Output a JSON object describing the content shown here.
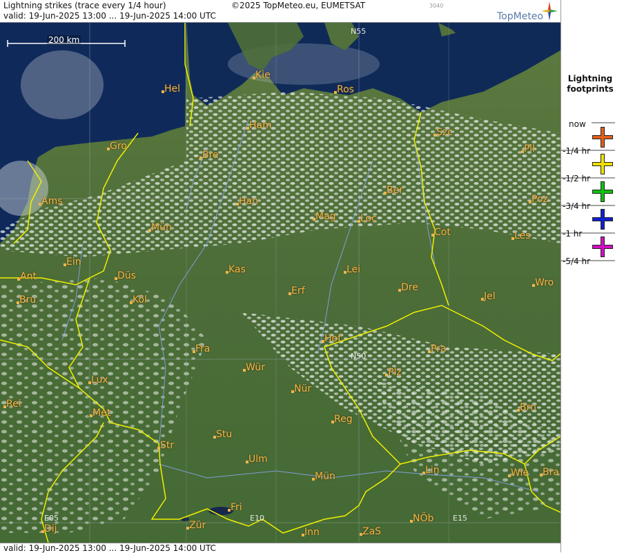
{
  "header": {
    "title": "Lightning strikes (trace every 1/4 hour)",
    "copyright": "©2025 TopMeteo.eu, EUMETSAT",
    "image_number": "3040",
    "valid": "valid:  19-Jun-2025 13:00 ... 19-Jun-2025 14:00 UTC",
    "logo": "TopMeteo"
  },
  "footer": {
    "valid": "valid:  19-Jun-2025 13:00 ... 19-Jun-2025 14:00 UTC"
  },
  "scale": {
    "label": "200 km"
  },
  "grid_labels": {
    "n55": "N55",
    "n50": "N50",
    "e05": "E05",
    "e10": "E10",
    "e15": "E15"
  },
  "legend": {
    "title_line1": "Lightning",
    "title_line2": "footprints",
    "items": [
      {
        "label": "now",
        "color": "#e0601a"
      },
      {
        "label": "-1/4 hr",
        "color": "#f0e000"
      },
      {
        "label": "-1/2 hr",
        "color": "#10c010"
      },
      {
        "label": "-3/4 hr",
        "color": "#1020d0"
      },
      {
        "label": "-1 hr",
        "color": "#d010c0"
      },
      {
        "label": "-5/4 hr",
        "color": ""
      }
    ]
  },
  "cities": [
    "Hel",
    "Kie",
    "Ros",
    "Ham",
    "Szc",
    "Gro",
    "Bre",
    "Pil",
    "Ber",
    "Ams",
    "Han",
    "Poz",
    "Mag",
    "Loc",
    "Mün",
    "Cot",
    "Les",
    "Ein",
    "Kas",
    "Lei",
    "Ant",
    "Düs",
    "Wro",
    "Dre",
    "Erf",
    "Bru",
    "Köl",
    "Jel",
    "Hof",
    "Fra",
    "Pra",
    "Wür",
    "Plz",
    "Lux",
    "Nür",
    "Rei",
    "Met",
    "Brn",
    "Reg",
    "Stu",
    "Str",
    "Ulm",
    "Lin",
    "Wie",
    "Bra",
    "Mün",
    "Fri",
    "NÖb",
    "Dij",
    "Zür",
    "Inn",
    "ZaS"
  ],
  "colors": {
    "land": "#4f6f3a",
    "sea": "#102a58",
    "border": "#f0f000",
    "city": "#f2b64a"
  }
}
